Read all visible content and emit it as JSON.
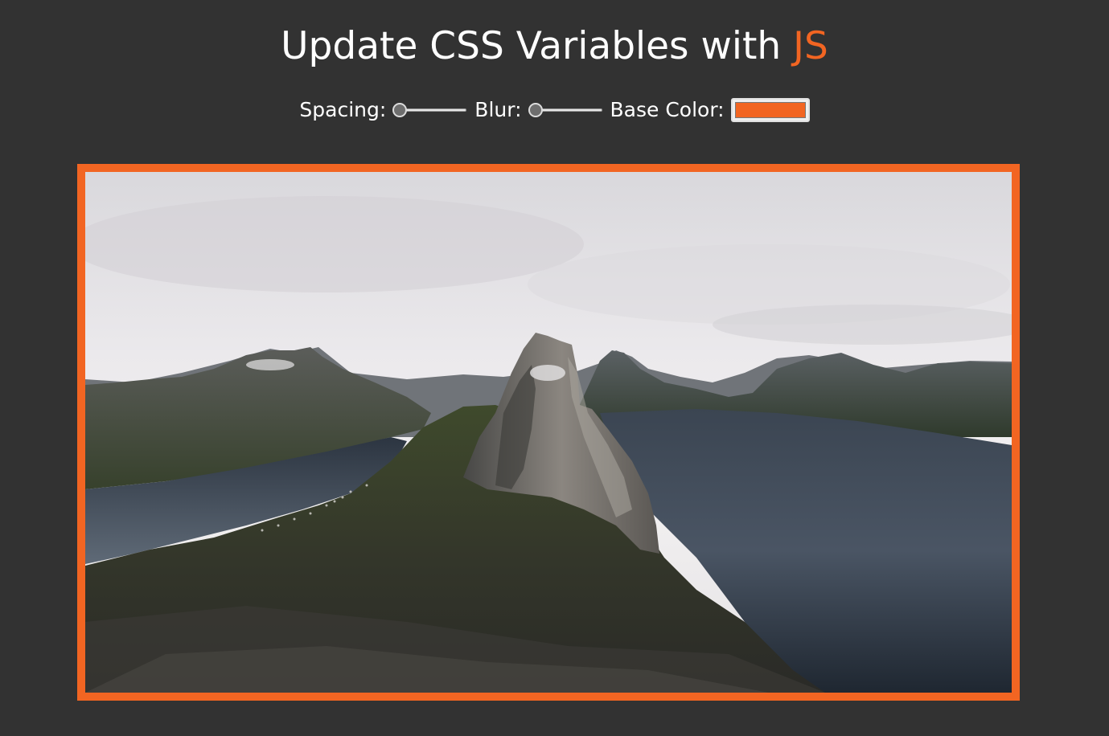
{
  "header": {
    "title_main": "Update CSS Variables with ",
    "title_accent": "JS",
    "accent_color": "#f26522"
  },
  "controls": {
    "spacing_label": "Spacing:",
    "blur_label": "Blur:",
    "base_color_label": "Base Color:",
    "spacing_value": 0,
    "blur_value": 0,
    "base_color_value": "#f26522"
  },
  "image": {
    "alt": "Mountain fjord landscape",
    "border_color": "#f26522"
  }
}
